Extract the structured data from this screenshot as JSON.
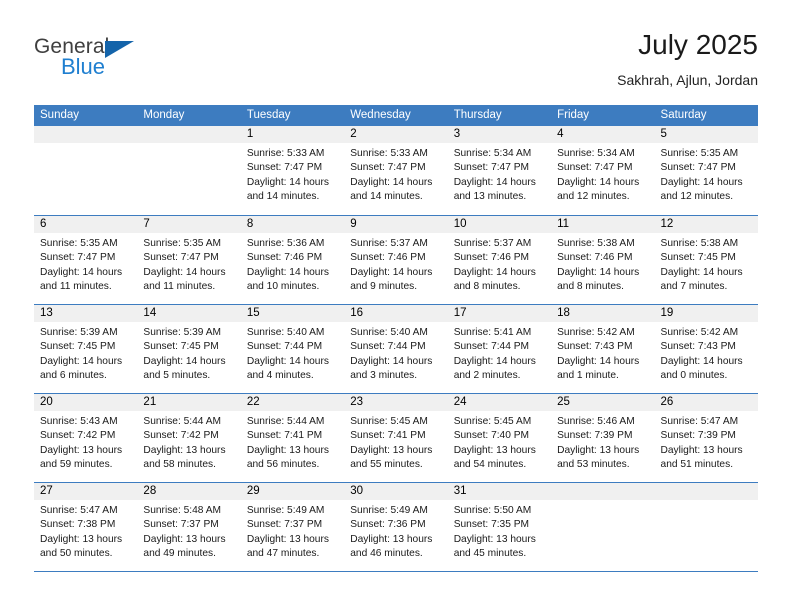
{
  "logo": {
    "word_one": "General",
    "word_two": "Blue",
    "triangle_icon": "triangle-icon",
    "brand_blue": "#1f7fd0",
    "triangle_blue": "#1464aa"
  },
  "header": {
    "title": "July 2025",
    "subtitle": "Sakhrah, Ajlun, Jordan"
  },
  "theme": {
    "header_bar": "#3d7cc0",
    "daynum_band": "#f0f0f0",
    "rule": "#3d7cc0"
  },
  "calendar": {
    "day_headers": [
      "Sunday",
      "Monday",
      "Tuesday",
      "Wednesday",
      "Thursday",
      "Friday",
      "Saturday"
    ],
    "weeks": [
      [
        {
          "day": "",
          "lines": []
        },
        {
          "day": "",
          "lines": []
        },
        {
          "day": "1",
          "lines": [
            "Sunrise: 5:33 AM",
            "Sunset: 7:47 PM",
            "Daylight: 14 hours and 14 minutes."
          ]
        },
        {
          "day": "2",
          "lines": [
            "Sunrise: 5:33 AM",
            "Sunset: 7:47 PM",
            "Daylight: 14 hours and 14 minutes."
          ]
        },
        {
          "day": "3",
          "lines": [
            "Sunrise: 5:34 AM",
            "Sunset: 7:47 PM",
            "Daylight: 14 hours and 13 minutes."
          ]
        },
        {
          "day": "4",
          "lines": [
            "Sunrise: 5:34 AM",
            "Sunset: 7:47 PM",
            "Daylight: 14 hours and 12 minutes."
          ]
        },
        {
          "day": "5",
          "lines": [
            "Sunrise: 5:35 AM",
            "Sunset: 7:47 PM",
            "Daylight: 14 hours and 12 minutes."
          ]
        }
      ],
      [
        {
          "day": "6",
          "lines": [
            "Sunrise: 5:35 AM",
            "Sunset: 7:47 PM",
            "Daylight: 14 hours and 11 minutes."
          ]
        },
        {
          "day": "7",
          "lines": [
            "Sunrise: 5:35 AM",
            "Sunset: 7:47 PM",
            "Daylight: 14 hours and 11 minutes."
          ]
        },
        {
          "day": "8",
          "lines": [
            "Sunrise: 5:36 AM",
            "Sunset: 7:46 PM",
            "Daylight: 14 hours and 10 minutes."
          ]
        },
        {
          "day": "9",
          "lines": [
            "Sunrise: 5:37 AM",
            "Sunset: 7:46 PM",
            "Daylight: 14 hours and 9 minutes."
          ]
        },
        {
          "day": "10",
          "lines": [
            "Sunrise: 5:37 AM",
            "Sunset: 7:46 PM",
            "Daylight: 14 hours and 8 minutes."
          ]
        },
        {
          "day": "11",
          "lines": [
            "Sunrise: 5:38 AM",
            "Sunset: 7:46 PM",
            "Daylight: 14 hours and 8 minutes."
          ]
        },
        {
          "day": "12",
          "lines": [
            "Sunrise: 5:38 AM",
            "Sunset: 7:45 PM",
            "Daylight: 14 hours and 7 minutes."
          ]
        }
      ],
      [
        {
          "day": "13",
          "lines": [
            "Sunrise: 5:39 AM",
            "Sunset: 7:45 PM",
            "Daylight: 14 hours and 6 minutes."
          ]
        },
        {
          "day": "14",
          "lines": [
            "Sunrise: 5:39 AM",
            "Sunset: 7:45 PM",
            "Daylight: 14 hours and 5 minutes."
          ]
        },
        {
          "day": "15",
          "lines": [
            "Sunrise: 5:40 AM",
            "Sunset: 7:44 PM",
            "Daylight: 14 hours and 4 minutes."
          ]
        },
        {
          "day": "16",
          "lines": [
            "Sunrise: 5:40 AM",
            "Sunset: 7:44 PM",
            "Daylight: 14 hours and 3 minutes."
          ]
        },
        {
          "day": "17",
          "lines": [
            "Sunrise: 5:41 AM",
            "Sunset: 7:44 PM",
            "Daylight: 14 hours and 2 minutes."
          ]
        },
        {
          "day": "18",
          "lines": [
            "Sunrise: 5:42 AM",
            "Sunset: 7:43 PM",
            "Daylight: 14 hours and 1 minute."
          ]
        },
        {
          "day": "19",
          "lines": [
            "Sunrise: 5:42 AM",
            "Sunset: 7:43 PM",
            "Daylight: 14 hours and 0 minutes."
          ]
        }
      ],
      [
        {
          "day": "20",
          "lines": [
            "Sunrise: 5:43 AM",
            "Sunset: 7:42 PM",
            "Daylight: 13 hours and 59 minutes."
          ]
        },
        {
          "day": "21",
          "lines": [
            "Sunrise: 5:44 AM",
            "Sunset: 7:42 PM",
            "Daylight: 13 hours and 58 minutes."
          ]
        },
        {
          "day": "22",
          "lines": [
            "Sunrise: 5:44 AM",
            "Sunset: 7:41 PM",
            "Daylight: 13 hours and 56 minutes."
          ]
        },
        {
          "day": "23",
          "lines": [
            "Sunrise: 5:45 AM",
            "Sunset: 7:41 PM",
            "Daylight: 13 hours and 55 minutes."
          ]
        },
        {
          "day": "24",
          "lines": [
            "Sunrise: 5:45 AM",
            "Sunset: 7:40 PM",
            "Daylight: 13 hours and 54 minutes."
          ]
        },
        {
          "day": "25",
          "lines": [
            "Sunrise: 5:46 AM",
            "Sunset: 7:39 PM",
            "Daylight: 13 hours and 53 minutes."
          ]
        },
        {
          "day": "26",
          "lines": [
            "Sunrise: 5:47 AM",
            "Sunset: 7:39 PM",
            "Daylight: 13 hours and 51 minutes."
          ]
        }
      ],
      [
        {
          "day": "27",
          "lines": [
            "Sunrise: 5:47 AM",
            "Sunset: 7:38 PM",
            "Daylight: 13 hours and 50 minutes."
          ]
        },
        {
          "day": "28",
          "lines": [
            "Sunrise: 5:48 AM",
            "Sunset: 7:37 PM",
            "Daylight: 13 hours and 49 minutes."
          ]
        },
        {
          "day": "29",
          "lines": [
            "Sunrise: 5:49 AM",
            "Sunset: 7:37 PM",
            "Daylight: 13 hours and 47 minutes."
          ]
        },
        {
          "day": "30",
          "lines": [
            "Sunrise: 5:49 AM",
            "Sunset: 7:36 PM",
            "Daylight: 13 hours and 46 minutes."
          ]
        },
        {
          "day": "31",
          "lines": [
            "Sunrise: 5:50 AM",
            "Sunset: 7:35 PM",
            "Daylight: 13 hours and 45 minutes."
          ]
        },
        {
          "day": "",
          "lines": []
        },
        {
          "day": "",
          "lines": []
        }
      ]
    ]
  }
}
